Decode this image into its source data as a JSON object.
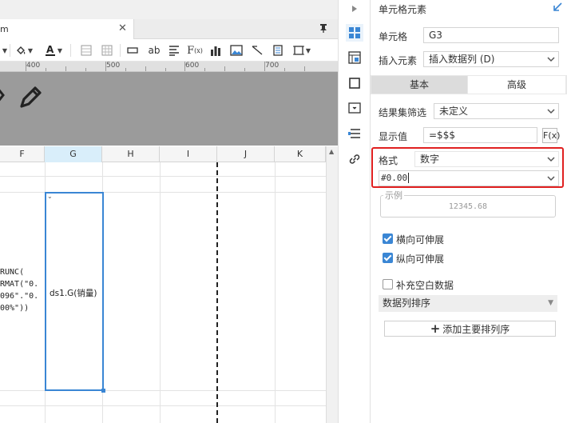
{
  "editor": {
    "tab_label": "m",
    "tab_close": "✕",
    "pin_icon": "pin-icon",
    "toolbar": [
      {
        "name": "format-painter-icon",
        "glyph": "✥"
      },
      {
        "name": "fill-color-icon",
        "glyph": "◈"
      },
      {
        "name": "font-color-icon",
        "glyph": "A"
      },
      {
        "name": "border-icon",
        "glyph": "▦"
      },
      {
        "name": "table-icon",
        "glyph": "▦"
      },
      {
        "name": "insert-row-icon",
        "glyph": "▭"
      },
      {
        "name": "text-icon",
        "glyph": "ab"
      },
      {
        "name": "align-icon",
        "glyph": "≡"
      },
      {
        "name": "formula-icon",
        "glyph": "Fx"
      },
      {
        "name": "chart-icon",
        "glyph": "▮"
      },
      {
        "name": "image-icon",
        "glyph": "▨"
      },
      {
        "name": "slash-icon",
        "glyph": "⟋"
      },
      {
        "name": "sub-report-icon",
        "glyph": "▤"
      },
      {
        "name": "frame-icon",
        "glyph": "▢"
      }
    ],
    "ruler": [
      "400",
      "500",
      "600",
      "700"
    ],
    "columns": [
      "F",
      "G",
      "H",
      "I",
      "J",
      "K"
    ],
    "selected_column": "G",
    "cell_f_text": "RUNC(\nRMAT(\"0.\n096\".\"0.\n00%\"))",
    "cell_g_text": "ds1.G(销量)",
    "accent": "#3a86d4"
  },
  "panel": {
    "title": "单元格元素",
    "cell_label": "单元格",
    "cell_value": "G3",
    "insert_label": "插入元素",
    "insert_value": "插入数据列 (D)",
    "tab_basic": "基本",
    "tab_advanced": "高级",
    "filter_label": "结果集筛选",
    "filter_value": "未定义",
    "display_label": "显示值",
    "display_value": "=$$$",
    "fx_label": "F(x)",
    "format_label": "格式",
    "format_value": "数字",
    "pattern_value": "#0.00",
    "example_label": "示例",
    "example_value": "12345.68",
    "h_extend_label": "横向可伸展",
    "v_extend_label": "纵向可伸展",
    "fill_blank_label": "补充空白数据",
    "sort_label": "数据列排序",
    "add_sort_label": "添加主要排列序",
    "add_sort_plus": "+",
    "highlight_color": "#e02020"
  }
}
